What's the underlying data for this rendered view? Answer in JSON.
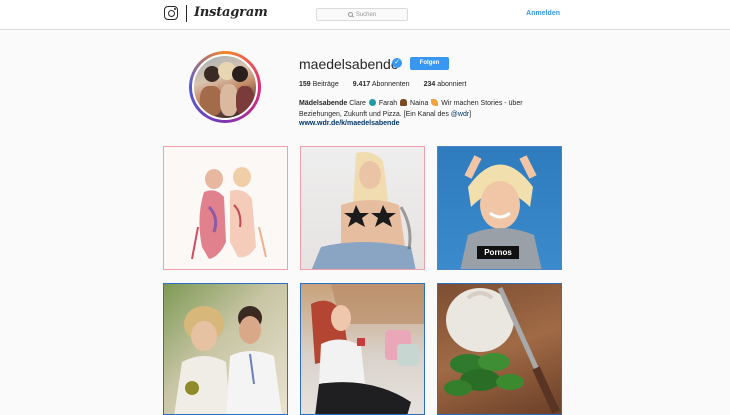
{
  "header": {
    "brand": "Instagram",
    "search_placeholder": "Suchen",
    "login_label": "Anmelden"
  },
  "profile": {
    "username": "maedelsabende",
    "verified_mark": "✓",
    "follow_label": "Folgen",
    "stats": [
      {
        "value": "159",
        "label": "Beiträge"
      },
      {
        "value": "9.417",
        "label": "Abonnenten"
      },
      {
        "value": "234",
        "label": "abonniert"
      }
    ],
    "bio_name": "Mädelsabende",
    "bio_text_1": "Clare",
    "bio_text_2": "Farah",
    "bio_text_3": "Naina",
    "bio_text_4": "Wir machen Stories - über Beziehungen, Zukunft und Pizza. [Ein Kanal des",
    "bio_mention": "@wdr",
    "bio_text_5": "]",
    "website": "www.wdr.de/k/maedelsabende"
  },
  "posts": [
    {
      "label": ""
    },
    {
      "label": ""
    },
    {
      "label": "Pornos"
    },
    {
      "label": ""
    },
    {
      "label": ""
    },
    {
      "label": ""
    }
  ],
  "colors": {
    "accent": "#3897f0",
    "link": "#003569"
  }
}
